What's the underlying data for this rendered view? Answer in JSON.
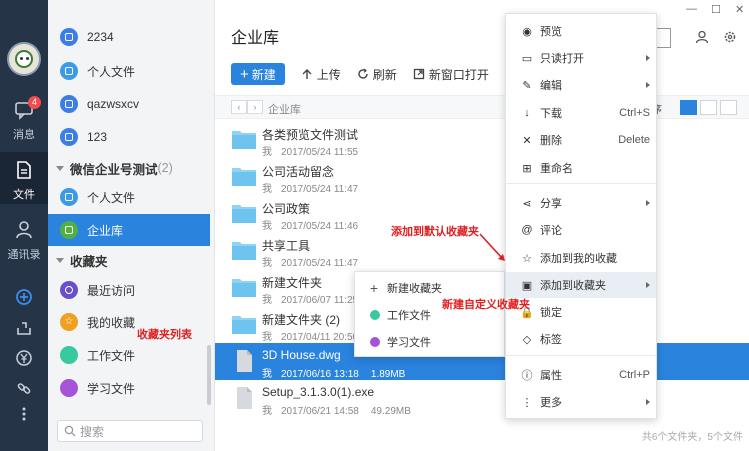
{
  "colors": {
    "accent": "#2a83dd",
    "rail": "#263448",
    "annotation": "#e02020",
    "folder": "#6fc3ef"
  },
  "rail": {
    "badge": "4",
    "items": [
      {
        "label": "消息",
        "icon": "chat-icon"
      },
      {
        "label": "文件",
        "icon": "file-icon"
      },
      {
        "label": "通讯录",
        "icon": "contacts-icon"
      }
    ]
  },
  "panel": {
    "rows_top": [
      {
        "label": "2234",
        "icon": "lock-file-icon",
        "color": "#3d7ee6"
      },
      {
        "label": "个人文件",
        "icon": "folder-icon",
        "color": "#3d9be6"
      },
      {
        "label": "qazwsxcv",
        "icon": "lock-file-icon",
        "color": "#3d7ee6"
      },
      {
        "label": "123",
        "icon": "lock-file-icon",
        "color": "#3d7ee6"
      }
    ],
    "section_wechat": {
      "title": "微信企业号测试",
      "count": "(2)"
    },
    "rows_wechat": [
      {
        "label": "个人文件",
        "icon": "folder-icon",
        "color": "#3d9be6"
      },
      {
        "label": "企业库",
        "icon": "library-icon",
        "color": "#52b043"
      }
    ],
    "section_fav": {
      "title": "收藏夹"
    },
    "rows_fav": [
      {
        "label": "最近访问",
        "icon": "clock-icon",
        "color": "#6a4fc8"
      },
      {
        "label": "我的收藏",
        "icon": "star-icon",
        "color": "#f0a020"
      },
      {
        "label": "工作文件",
        "icon": "dot-icon",
        "color": "#38c9a0"
      },
      {
        "label": "学习文件",
        "icon": "dot-icon",
        "color": "#a454d8"
      }
    ],
    "search_placeholder": "搜索",
    "annotation_list": "收藏夹列表"
  },
  "main": {
    "title": "企业库",
    "toolbar": {
      "new": "新建",
      "upload": "上传",
      "refresh": "刷新",
      "new_window": "新窗口打开"
    },
    "crumb": "企业库",
    "sort_fragment": "序",
    "files": [
      {
        "name": "各类预览文件测试",
        "owner": "我",
        "date": "2017/05/24 11:55",
        "size": "",
        "type": "folder"
      },
      {
        "name": "公司活动留念",
        "owner": "我",
        "date": "2017/05/24 11:47",
        "size": "",
        "type": "folder"
      },
      {
        "name": "公司政策",
        "owner": "我",
        "date": "2017/05/24 11:46",
        "size": "",
        "type": "folder"
      },
      {
        "name": "共享工具",
        "owner": "我",
        "date": "2017/05/24 11:47",
        "size": "",
        "type": "folder"
      },
      {
        "name": "新建文件夹",
        "owner": "我",
        "date": "2017/06/07 11:25",
        "size": "",
        "type": "folder"
      },
      {
        "name": "新建文件夹 (2)",
        "owner": "我",
        "date": "2017/04/11 20:50",
        "size": "",
        "type": "folder"
      },
      {
        "name": "3D House.dwg",
        "owner": "我",
        "date": "2017/06/16 13:18",
        "size": "1.89MB",
        "type": "file"
      },
      {
        "name": "Setup_3.1.3.0(1).exe",
        "owner": "我",
        "date": "2017/06/21 14:58",
        "size": "49.29MB",
        "type": "file"
      }
    ],
    "footer": "共6个文件夹，5个文件"
  },
  "context_menu": [
    {
      "label": "预览",
      "icon": "eye-icon",
      "shortcut": "",
      "arrow": false
    },
    {
      "label": "只读打开",
      "icon": "open-folder-icon",
      "shortcut": "",
      "arrow": true
    },
    {
      "label": "编辑",
      "icon": "pen-icon",
      "shortcut": "",
      "arrow": true
    },
    {
      "label": "下载",
      "icon": "download-icon",
      "shortcut": "Ctrl+S",
      "arrow": false
    },
    {
      "label": "删除",
      "icon": "delete-icon",
      "shortcut": "Delete",
      "arrow": false
    },
    {
      "label": "重命名",
      "icon": "rename-icon",
      "shortcut": "",
      "arrow": false
    },
    {
      "label": "分享",
      "icon": "share-icon",
      "shortcut": "",
      "arrow": true
    },
    {
      "label": "评论",
      "icon": "at-icon",
      "shortcut": "",
      "arrow": false
    },
    {
      "label": "添加到我的收藏",
      "icon": "star-outline-icon",
      "shortcut": "",
      "arrow": false
    },
    {
      "label": "添加到收藏夹",
      "icon": "folder-add-icon",
      "shortcut": "",
      "arrow": true
    },
    {
      "label": "锁定",
      "icon": "lock-icon",
      "shortcut": "",
      "arrow": false
    },
    {
      "label": "标签",
      "icon": "tag-icon",
      "shortcut": "",
      "arrow": false
    },
    {
      "label": "属性",
      "icon": "info-icon",
      "shortcut": "Ctrl+P",
      "arrow": false
    },
    {
      "label": "更多",
      "icon": "more-icon",
      "shortcut": "",
      "arrow": true
    }
  ],
  "submenu": [
    {
      "label": "新建收藏夹",
      "icon": "plus-icon",
      "color": ""
    },
    {
      "label": "工作文件",
      "icon": "dot-icon",
      "color": "#38c9a0"
    },
    {
      "label": "学习文件",
      "icon": "dot-icon",
      "color": "#a454d8"
    }
  ],
  "annotations": {
    "default_fav": "添加到默认收藏夹",
    "custom_fav": "新建自定义收藏夹"
  }
}
